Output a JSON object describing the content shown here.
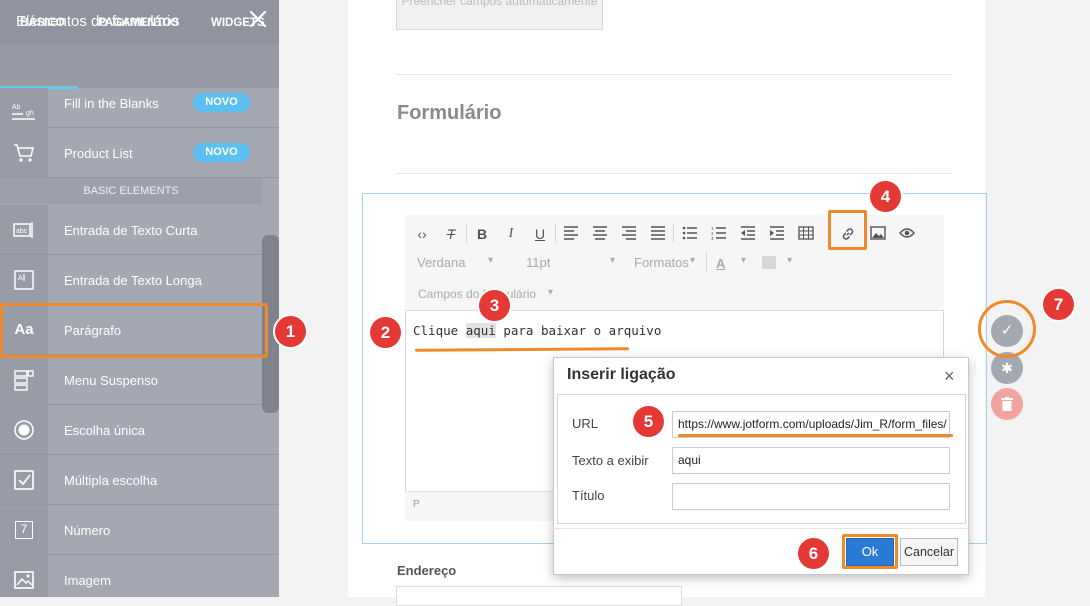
{
  "sidebar": {
    "title": "Elementos do formulário",
    "tabs": [
      "BÁSICO",
      "PAGAMENTOS",
      "WIDGETS"
    ],
    "section_label": "BASIC ELEMENTS",
    "items": [
      {
        "label": "Fill in the Blanks",
        "badge": "NOVO",
        "icon": "fill-blanks-icon"
      },
      {
        "label": "Product List",
        "badge": "NOVO",
        "icon": "cart-icon"
      },
      {
        "label": "Entrada de Texto Curta",
        "icon": "short-text-icon"
      },
      {
        "label": "Entrada de Texto Longa",
        "icon": "long-text-icon"
      },
      {
        "label": "Parágrafo",
        "icon": "paragraph-icon",
        "icon_text": "Aa"
      },
      {
        "label": "Menu Suspenso",
        "icon": "dropdown-icon"
      },
      {
        "label": "Escolha única",
        "icon": "radio-icon"
      },
      {
        "label": "Múltipla escolha",
        "icon": "checkbox-icon"
      },
      {
        "label": "Número",
        "icon": "number-icon",
        "icon_text": "7"
      },
      {
        "label": "Imagem",
        "icon": "image-icon"
      }
    ]
  },
  "form": {
    "autofill_button": "Preencher campos automaticamente",
    "title": "Formulário",
    "address_label": "Endereço"
  },
  "editor": {
    "font_family": "Verdana",
    "font_size": "11pt",
    "formats": "Formatos",
    "form_fields": "Campos do formulário",
    "text_before": "Clique ",
    "text_link": "aqui",
    "text_after": " para baixar o arquivo",
    "footer_path": "P"
  },
  "dialog": {
    "title": "Inserir ligação",
    "url_label": "URL",
    "url_value": "https://www.jotform.com/uploads/Jim_R/form_files/",
    "text_label": "Texto a exibir",
    "text_value": "aqui",
    "title_label": "Título",
    "title_value": "",
    "ok_label": "Ok",
    "cancel_label": "Cancelar"
  },
  "markers": [
    "1",
    "2",
    "3",
    "4",
    "5",
    "6",
    "7"
  ],
  "colors": {
    "annotation": "#f0892a",
    "marker": "#e53935",
    "ok_button": "#2a7bd6",
    "badge": "#5bc0ef"
  }
}
